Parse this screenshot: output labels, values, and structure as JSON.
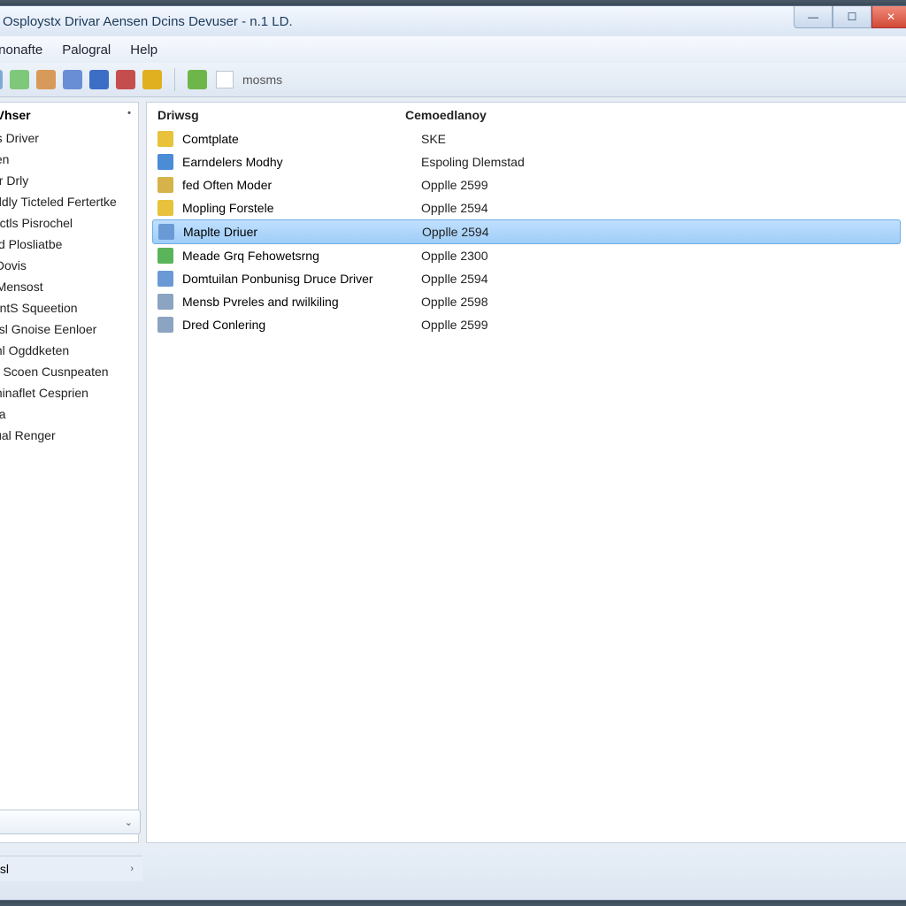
{
  "window_title": "Osploystx Drivar Aensen Dcins Devuser - n.1 LD.",
  "menus": [
    "Cnnonafte",
    "Palogral",
    "Help"
  ],
  "toolbar": {
    "icons": [
      {
        "name": "doc-icon",
        "color": "#7fa8d6"
      },
      {
        "name": "refresh-icon",
        "color": "#7fc87a"
      },
      {
        "name": "clipboard-icon",
        "color": "#d89a5a"
      },
      {
        "name": "cut-icon",
        "color": "#6a8ed6"
      },
      {
        "name": "globe-icon",
        "color": "#3b6ec4"
      },
      {
        "name": "stop-icon",
        "color": "#c64d4d"
      },
      {
        "name": "app-icon",
        "color": "#e0b020"
      }
    ],
    "play_icon": {
      "name": "play-icon",
      "color": "#6fb64a"
    },
    "field_label": "mosms"
  },
  "left_panel": {
    "header": "e Vhser",
    "items": [
      "fas Driver",
      "leen",
      "sar Drly",
      "al ldly Ticteled Fertertke",
      "aactls Pisrochel",
      "ajid Plosliatbe",
      "s Dovis",
      "e Mensost",
      "nentS Squeetion",
      "atisl Gnoise Eenloer",
      "lenl Ogddketen",
      "an Scoen Cusnpeaten",
      "olninaflet Cesprien",
      "inta",
      "Dual Renger"
    ]
  },
  "right_panel": {
    "col1": "Driwsg",
    "col2": "Cemoedlanoy",
    "rows": [
      {
        "icon": "star-icon",
        "c": "#e8c23a",
        "n": "Comtplate",
        "v": "SKE",
        "sel": false
      },
      {
        "icon": "device-icon",
        "c": "#4a8cd6",
        "n": "Earndelers Modhy",
        "v": "Espoling Dlemstad",
        "sel": false
      },
      {
        "icon": "chip-icon",
        "c": "#d6b24a",
        "n": "fed Often Moder",
        "v": "Opplle 2599",
        "sel": false
      },
      {
        "icon": "gear-icon",
        "c": "#e8c23a",
        "n": "Mopling Forstele",
        "v": "Opplle 2594",
        "sel": false
      },
      {
        "icon": "driver-icon",
        "c": "#6a9ad6",
        "n": "Maplte Driuer",
        "v": "Opplle 2594",
        "sel": true
      },
      {
        "icon": "app-icon",
        "c": "#5ab45a",
        "n": "Meade Grq Fehowetsrng",
        "v": "Opplle 2300",
        "sel": false
      },
      {
        "icon": "monitor-icon",
        "c": "#6a9ad6",
        "n": "Domtuilan Ponbunisg Druce Driver",
        "v": "Opplle 2594",
        "sel": false
      },
      {
        "icon": "card-icon",
        "c": "#8aa4c2",
        "n": "Mensb Pvreles and rwilkiling",
        "v": "Opplle 2598",
        "sel": false
      },
      {
        "icon": "doc-icon",
        "c": "#8aa4c2",
        "n": "Dred Conlering",
        "v": "Opplle 2599",
        "sel": false
      }
    ]
  },
  "bottom_panel_label": "amentsl"
}
